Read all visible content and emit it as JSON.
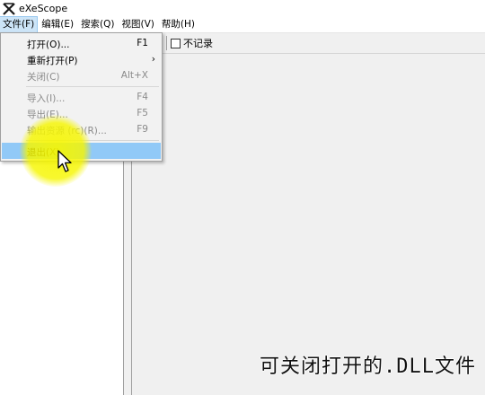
{
  "window": {
    "title": "eXeScope"
  },
  "menubar": [
    {
      "label": "文件(F)",
      "active": true
    },
    {
      "label": "编辑(E)"
    },
    {
      "label": "搜索(Q)"
    },
    {
      "label": "视图(V)"
    },
    {
      "label": "帮助(H)"
    }
  ],
  "toolbar": {
    "no_record_label": "不记录"
  },
  "file_menu": {
    "items": [
      {
        "label": "打开(O)...",
        "shortcut": "F1",
        "enabled": true
      },
      {
        "label": "重新打开(P)",
        "shortcut": "›",
        "enabled": true
      },
      {
        "label": "关闭(C)",
        "shortcut": "Alt+X",
        "enabled": false
      },
      {
        "label": "导入(I)...",
        "shortcut": "F4",
        "enabled": false
      },
      {
        "label": "导出(E)...",
        "shortcut": "F5",
        "enabled": false
      },
      {
        "label": "输出资源 (rc)(R)...",
        "shortcut": "F9",
        "enabled": false
      },
      {
        "label": "退出(X)",
        "shortcut": "",
        "enabled": true,
        "highlighted": true
      }
    ]
  },
  "overlay": {
    "caption": "可关闭打开的.DLL文件",
    "highlight_color": "#f6f600"
  },
  "icons": {
    "app": "exescope-app-icon",
    "cursor": "mouse-pointer-icon"
  }
}
